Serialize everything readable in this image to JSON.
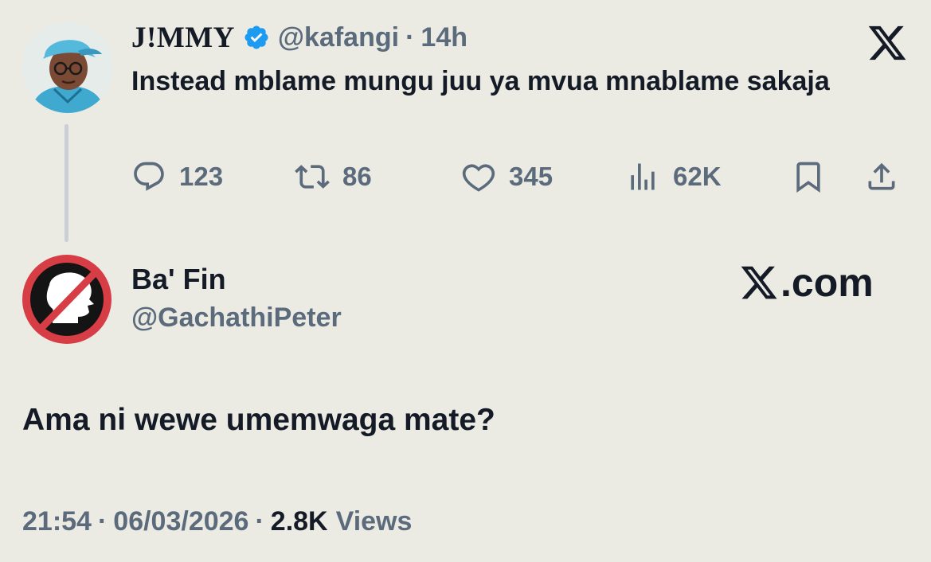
{
  "quoted_tweet": {
    "display_name": "J!MMY",
    "handle": "@kafangi",
    "separator": "·",
    "time": "14h",
    "text": "Instead mblame mungu juu ya mvua mnablame sakaja",
    "verified": true,
    "stats": {
      "replies": "123",
      "reposts": "86",
      "likes": "345",
      "views": "62K"
    },
    "icons": [
      "reply-icon",
      "repost-icon",
      "like-icon",
      "views-icon",
      "bookmark-icon",
      "share-icon",
      "x-logo-icon",
      "verified-badge-icon"
    ]
  },
  "reply_tweet": {
    "display_name": "Ba' Fin",
    "handle": "@GachathiPeter",
    "text": "Ama ni wewe umemwaga mate?",
    "site_label": ".com",
    "meta": {
      "time": "21:54",
      "separator": "·",
      "date": "06/03/2026",
      "views_count": "2.8K",
      "views_label": "Views"
    }
  },
  "colors": {
    "background": "#ebebe4",
    "text_primary": "#141b26",
    "text_secondary": "#5b6b7c",
    "verified_blue": "#1d9bf0",
    "thread_line": "#c9cfd4",
    "no_sign_red": "#d63d45"
  }
}
